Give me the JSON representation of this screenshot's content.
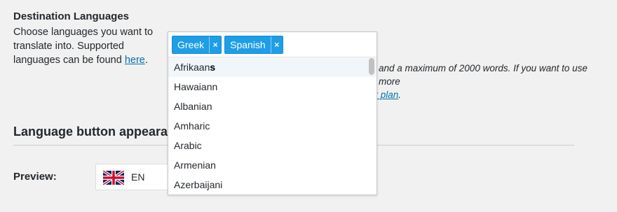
{
  "destination": {
    "title": "Destination Languages",
    "desc_part1": "Choose languages you want to translate into. Supported languages can be found ",
    "link": "here",
    "desc_part2": "."
  },
  "note": {
    "line1": "and a maximum of 2000 words. If you want to use more",
    "line2_link": "ur plan",
    "line2_end": "."
  },
  "multiselect": {
    "selected": [
      {
        "label": "Greek",
        "remove": "×"
      },
      {
        "label": "Spanish",
        "remove": "×"
      }
    ],
    "highlight_query": "s",
    "options": [
      "Afrikaans",
      "Hawaiann",
      "Albanian",
      "Amharic",
      "Arabic",
      "Armenian",
      "Azerbaijani"
    ]
  },
  "appearance": {
    "title": "Language button appearance",
    "preview_label": "Preview:",
    "preview_code": "EN",
    "preview_flag": "uk-flag-icon"
  }
}
